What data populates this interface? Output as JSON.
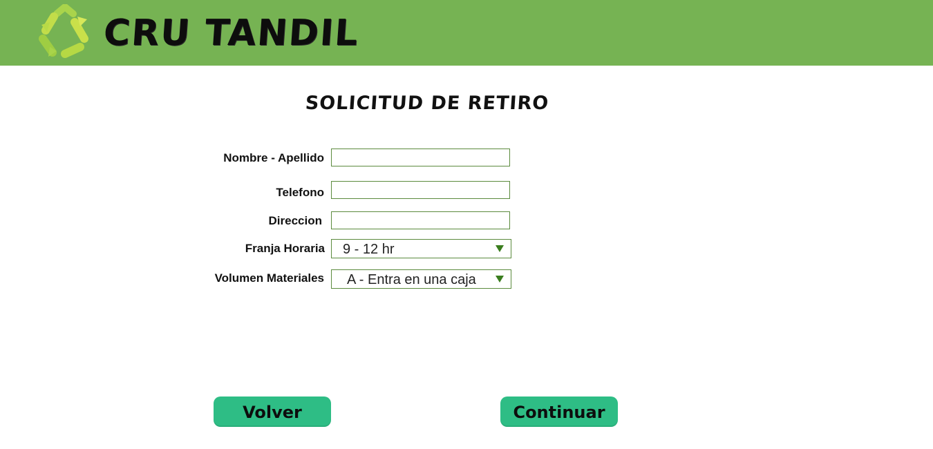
{
  "header": {
    "brand": "CRU TANDIL",
    "logo_icon": "recycle-icon",
    "background_color": "#76b353"
  },
  "form": {
    "title": "SOLICITUD DE RETIRO",
    "fields": {
      "nombre_label": "Nombre - Apellido",
      "nombre_value": "",
      "telefono_label": "Telefono",
      "telefono_value": "",
      "direccion_label": "Direccion",
      "direccion_value": "",
      "franja_label": "Franja Horaria",
      "franja_value": "9 - 12 hr",
      "volumen_label": "Volumen Materiales",
      "volumen_value": "A - Entra en una caja"
    },
    "border_color": "#5a8a3c"
  },
  "buttons": {
    "back_label": "Volver",
    "continue_label": "Continuar",
    "color": "#2ebd85"
  }
}
